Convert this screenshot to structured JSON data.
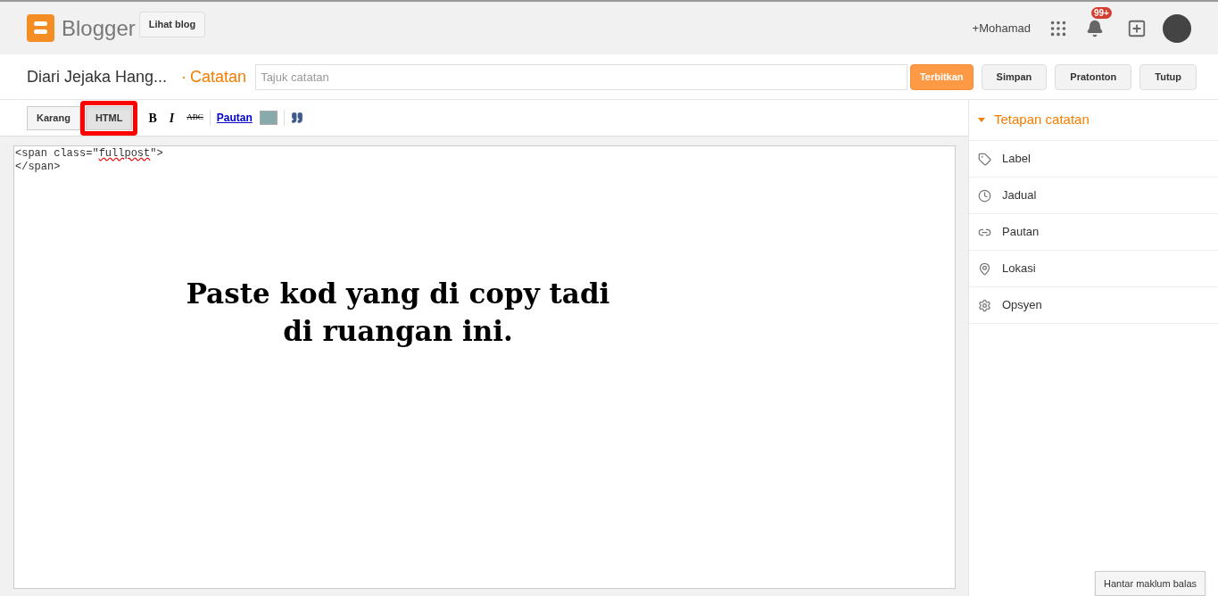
{
  "header": {
    "logo_text": "Blogger",
    "view_blog_button": "Lihat blog",
    "user_link": "+Mohamad",
    "notification_badge": "99+"
  },
  "post_bar": {
    "blog_title": "Diari Jejaka Hang...",
    "separator": "·",
    "section": "Catatan",
    "title_field": {
      "placeholder": "Tajuk catatan"
    },
    "buttons": [
      {
        "label": "Terbitkan",
        "kind": "primary"
      },
      {
        "label": "Simpan",
        "kind": "normal"
      },
      {
        "label": "Pratonton",
        "kind": "normal"
      },
      {
        "label": "Tutup",
        "kind": "normal"
      }
    ]
  },
  "toolbar": {
    "modes": [
      {
        "label": "Karang",
        "selected": false,
        "highlighted": false
      },
      {
        "label": "HTML",
        "selected": true,
        "highlighted": true
      }
    ],
    "format_buttons": [
      {
        "label": "B",
        "kind": "bold"
      },
      {
        "label": "I",
        "kind": "italic"
      },
      {
        "label": "ABC",
        "kind": "strike"
      }
    ],
    "link_button": "Pautan"
  },
  "editor": {
    "lines": [
      [
        {
          "text": "<span class=\"",
          "spell_error": false
        },
        {
          "text": "fullpost",
          "spell_error": true
        },
        {
          "text": "\">",
          "spell_error": false
        }
      ],
      [
        {
          "text": "</span>",
          "spell_error": false
        }
      ]
    ],
    "annotation_lines": [
      "Paste kod yang di copy tadi",
      "di ruangan ini."
    ]
  },
  "sidebar": {
    "heading": "Tetapan catatan",
    "expanded": true,
    "items": [
      {
        "label": "Label",
        "kind": "tag"
      },
      {
        "label": "Jadual",
        "kind": "clock"
      },
      {
        "label": "Pautan",
        "kind": "link"
      },
      {
        "label": "Lokasi",
        "kind": "pin"
      },
      {
        "label": "Opsyen",
        "kind": "gear"
      }
    ]
  },
  "feedback_button": "Hantar maklum balas"
}
